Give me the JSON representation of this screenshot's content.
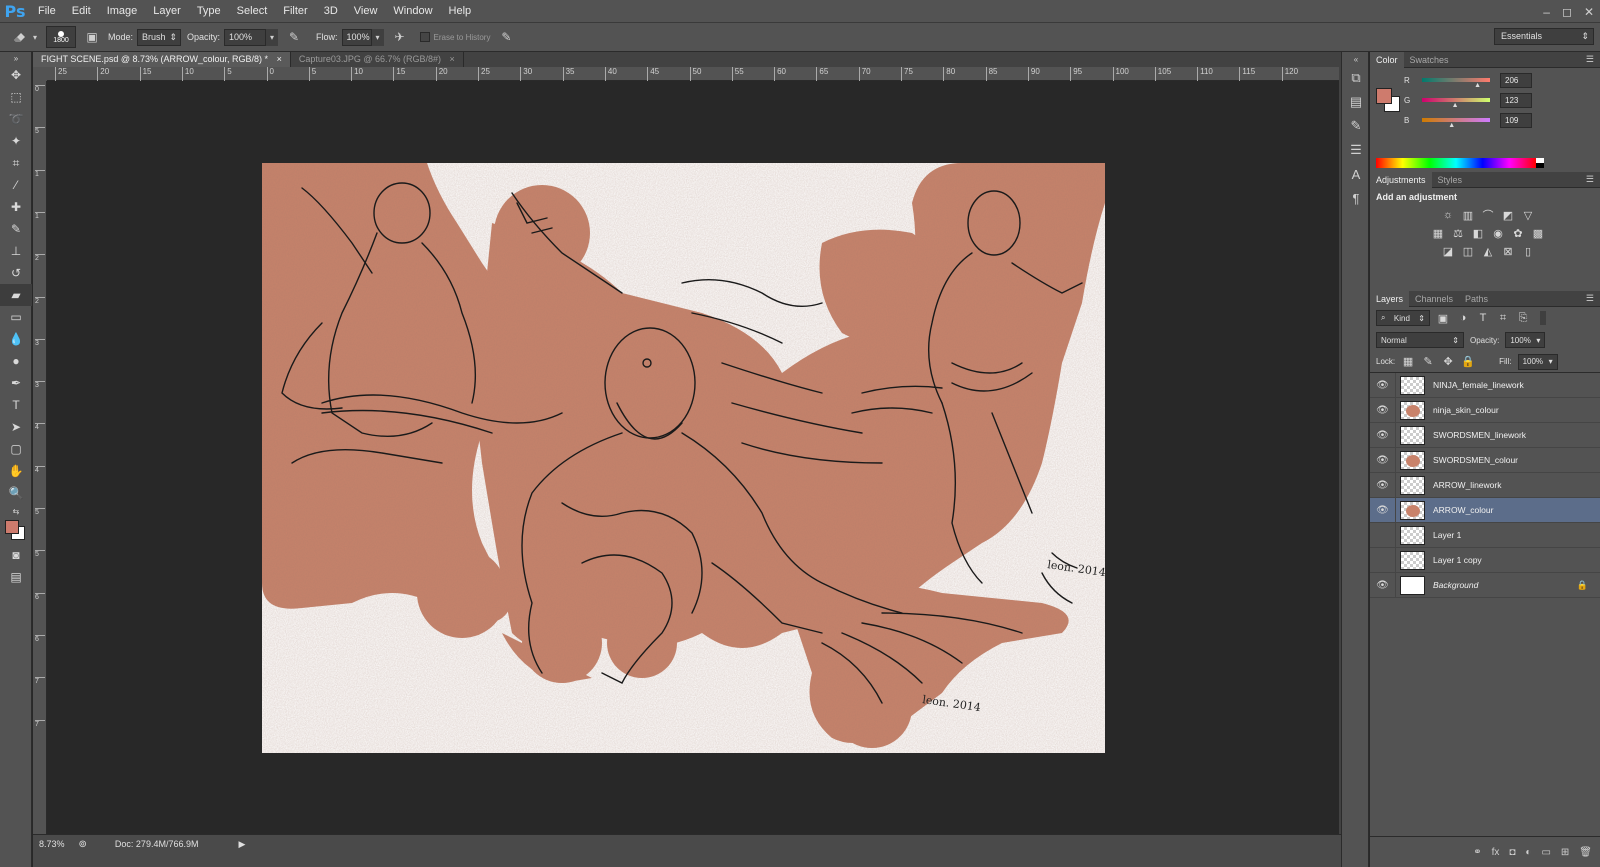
{
  "app": {
    "logo": "Ps"
  },
  "menu": [
    "File",
    "Edit",
    "Image",
    "Layer",
    "Type",
    "Select",
    "Filter",
    "3D",
    "View",
    "Window",
    "Help"
  ],
  "window_controls": [
    "–",
    "◻",
    "✕"
  ],
  "options": {
    "brush_size": "1800",
    "mode_label": "Mode:",
    "mode_value": "Brush",
    "opacity_label": "Opacity:",
    "opacity_value": "100%",
    "flow_label": "Flow:",
    "flow_value": "100%",
    "erase_history": "Erase to History",
    "workspace": "Essentials"
  },
  "tabs": [
    {
      "label": "FIGHT SCENE.psd @ 8.73% (ARROW_colour, RGB/8) *",
      "active": true
    },
    {
      "label": "Capture03.JPG @ 66.7% (RGB/8#)",
      "active": false
    }
  ],
  "ruler": {
    "h": [
      "25",
      "20",
      "15",
      "10",
      "5",
      "0",
      "5",
      "10",
      "15",
      "20",
      "25",
      "30",
      "35",
      "40",
      "45",
      "50",
      "55",
      "60",
      "65",
      "70",
      "75",
      "80",
      "85",
      "90",
      "95",
      "100",
      "105",
      "110",
      "115",
      "120"
    ],
    "v": [
      "0",
      "5",
      "1",
      "1",
      "2",
      "2",
      "3",
      "3",
      "4",
      "4",
      "5",
      "5",
      "6",
      "6",
      "7",
      "7"
    ]
  },
  "status": {
    "zoom": "8.73%",
    "doc": "Doc: 279.4M/766.9M"
  },
  "colors": {
    "foreground": "#ce7b6d",
    "skin": "#c8826a",
    "skin_dark": "#b06e55",
    "accent": "#5c6d8a"
  },
  "color_panel": {
    "tabs": [
      "Color",
      "Swatches"
    ],
    "channels": [
      {
        "label": "R",
        "value": "206",
        "fraction": 0.81
      },
      {
        "label": "G",
        "value": "123",
        "fraction": 0.48
      },
      {
        "label": "B",
        "value": "109",
        "fraction": 0.43
      }
    ]
  },
  "adjustments": {
    "tabs": [
      "Adjustments",
      "Styles"
    ],
    "title": "Add an adjustment"
  },
  "layers_panel": {
    "tabs": [
      "Layers",
      "Channels",
      "Paths"
    ],
    "kind": "Kind",
    "blend": "Normal",
    "opacity_label": "Opacity:",
    "opacity": "100%",
    "lock_label": "Lock:",
    "fill_label": "Fill:",
    "fill": "100%",
    "layers": [
      {
        "name": "NINJA_female_linework",
        "visible": true,
        "colored": false,
        "selected": false
      },
      {
        "name": "ninja_skin_colour",
        "visible": true,
        "colored": true,
        "selected": false
      },
      {
        "name": "SWORDSMEN_linework",
        "visible": true,
        "colored": false,
        "selected": false
      },
      {
        "name": "SWORDSMEN_colour",
        "visible": true,
        "colored": true,
        "selected": false
      },
      {
        "name": "ARROW_linework",
        "visible": true,
        "colored": false,
        "selected": false
      },
      {
        "name": "ARROW_colour",
        "visible": true,
        "colored": true,
        "selected": true
      },
      {
        "name": "Layer 1",
        "visible": false,
        "colored": false,
        "selected": false
      },
      {
        "name": "Layer 1 copy",
        "visible": false,
        "colored": false,
        "selected": false
      },
      {
        "name": "Background",
        "visible": true,
        "colored": false,
        "selected": false,
        "locked": true
      }
    ]
  },
  "artwork": {
    "signature_1": "leon. 2014",
    "signature_2": "leon. 2014"
  }
}
